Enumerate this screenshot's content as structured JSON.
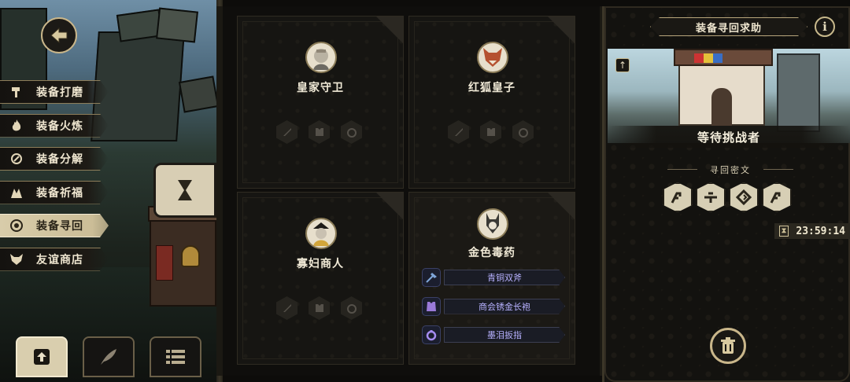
{
  "side_menu": {
    "items": [
      {
        "label": "装备打磨",
        "icon": "hammer-icon",
        "active": false
      },
      {
        "label": "装备火炼",
        "icon": "flame-icon",
        "active": false
      },
      {
        "label": "装备分解",
        "icon": "swirl-icon",
        "active": false
      },
      {
        "label": "装备祈福",
        "icon": "blessing-icon",
        "active": false
      },
      {
        "label": "装备寻回",
        "icon": "target-icon",
        "active": true
      },
      {
        "label": "友谊商店",
        "icon": "fox-icon",
        "active": false
      }
    ]
  },
  "bottom_buttons": [
    {
      "icon": "upload-icon",
      "active": true
    },
    {
      "icon": "feather-icon",
      "active": false
    },
    {
      "icon": "list-icon",
      "active": false
    }
  ],
  "cards": [
    {
      "name": "皇家守卫",
      "avatar": "royal-guard-avatar"
    },
    {
      "name": "红狐皇子",
      "avatar": "red-fox-prince-avatar"
    },
    {
      "name": "寡妇商人",
      "avatar": "widow-merchant-avatar"
    },
    {
      "name": "金色毒药",
      "avatar": "golden-poison-avatar",
      "rewards": [
        {
          "label": "青铜双斧",
          "icon": "axe-icon"
        },
        {
          "label": "商会锈金长袍",
          "icon": "robe-icon"
        },
        {
          "label": "墨泪扳指",
          "icon": "ring-icon"
        }
      ]
    }
  ],
  "right_panel": {
    "title": "装备寻回求助",
    "info": "i",
    "status": "等待挑战者",
    "cipher_label": "寻回密文",
    "runes": [
      "rune-1-icon",
      "rune-2-icon",
      "rune-3-icon",
      "rune-4-icon"
    ],
    "timer": "23:59:14"
  },
  "colors": {
    "accent": "#c9b68a",
    "reward_text": "#b7b1ff",
    "active_menu": "#d8ccaa"
  }
}
